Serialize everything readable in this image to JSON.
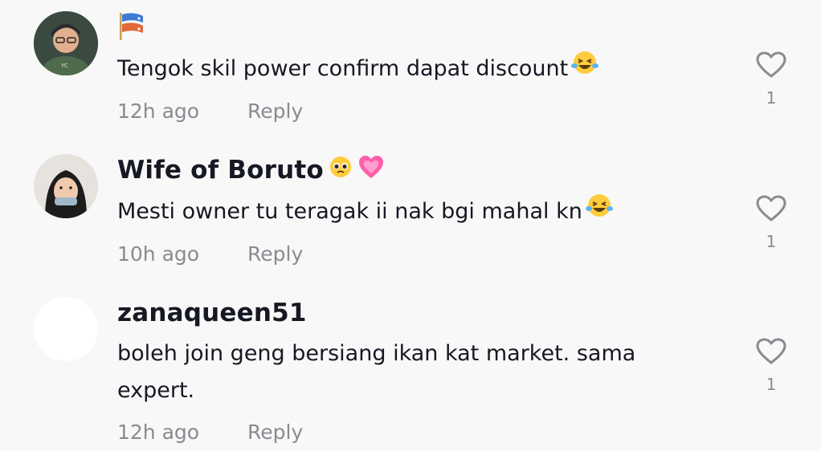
{
  "comments": [
    {
      "username": "",
      "text": "Tengok skil power confirm dapat discount",
      "time": "12h ago",
      "reply": "Reply",
      "likes": "1",
      "emojis": [
        "flag-icon",
        "laughing-emoji"
      ]
    },
    {
      "username": "Wife of Boruto",
      "text": "Mesti owner tu teragak ii nak bgi mahal kn",
      "time": "10h ago",
      "reply": "Reply",
      "likes": "1",
      "emojis": [
        "pleading-face-emoji",
        "sparkling-heart-emoji",
        "laughing-emoji"
      ]
    },
    {
      "username": "zanaqueen51",
      "text": "boleh join geng bersiang ikan kat market. sama expert.",
      "time": "12h ago",
      "reply": "Reply",
      "likes": "1",
      "emojis": []
    }
  ],
  "colors": {
    "background": "#f8f8f8",
    "text": "#161823",
    "muted": "#8a8b91"
  }
}
